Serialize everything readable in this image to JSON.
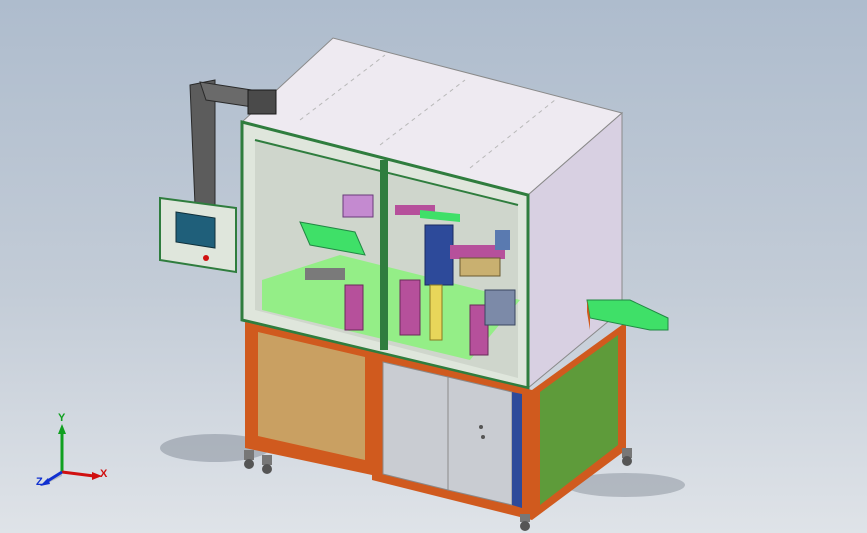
{
  "viewport": {
    "background_top": "#aebccd",
    "background_bottom": "#dfe3e8"
  },
  "machine": {
    "colors": {
      "frame_green": "#2f7d3e",
      "cover_panel": "#e8e1ec",
      "cover_side": "#d6cde0",
      "base_frame_orange": "#d05a1e",
      "base_left_panel": "#c9a062",
      "base_right_panel": "#5e9b3a",
      "door_grey": "#c9ccd2",
      "conveyor_green": "#3fe068",
      "column_pink": "#b6509b",
      "hmi_screen": "#1f5f7a"
    }
  },
  "triad": {
    "x_label": "X",
    "y_label": "Y",
    "z_label": "Z",
    "x_color": "#d01010",
    "y_color": "#10a020",
    "z_color": "#1030d0"
  }
}
